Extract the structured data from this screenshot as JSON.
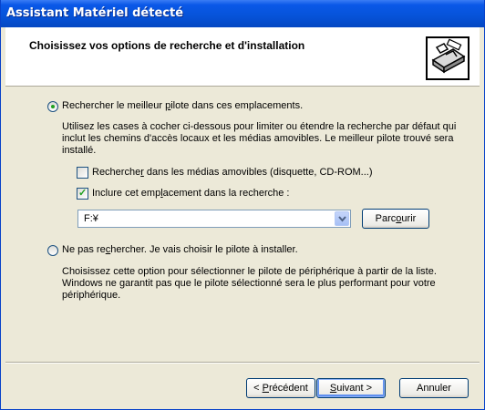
{
  "window": {
    "title": "Assistant Matériel détecté"
  },
  "header": {
    "heading": "Choisissez vos options de recherche et d'installation"
  },
  "options": {
    "search_best": {
      "label_pre": "Rechercher le meilleur ",
      "label_u": "p",
      "label_post": "ilote dans ces emplacements.",
      "description": "Utilisez les cases à cocher ci-dessous pour limiter ou étendre la recherche par défaut qui inclut les chemins d'accès locaux et les médias amovibles. Le meilleur pilote trouvé sera installé.",
      "checked": true
    },
    "removable_media": {
      "label_pre": "Recherche",
      "label_u": "r",
      "label_post": " dans les médias amovibles (disquette, CD-ROM...)",
      "checked": false
    },
    "include_location": {
      "label_pre": "Inclure cet emp",
      "label_u": "l",
      "label_post": "acement dans la recherche :",
      "checked": true
    },
    "location_value": "F:¥",
    "browse_button": {
      "pre": "Parc",
      "u": "o",
      "post": "urir"
    },
    "no_search": {
      "label_pre": "Ne pas re",
      "label_u": "c",
      "label_post": "hercher. Je vais choisir le pilote à installer.",
      "description": "Choisissez cette option pour sélectionner le pilote de périphérique à partir de la liste. Windows ne garantit pas que le pilote sélectionné sera le plus performant pour votre périphérique.",
      "checked": false
    }
  },
  "footer": {
    "back": {
      "pre": "< ",
      "u": "P",
      "post": "récédent"
    },
    "next": {
      "pre": "",
      "u": "S",
      "post": "uivant >"
    },
    "cancel": "Annuler"
  },
  "colors": {
    "titlebar": "#0653d8",
    "dialog": "#ece9d8",
    "radio_dot": "#21a121"
  },
  "icons": {
    "header": "hardware-wizard-icon",
    "dropdown": "chevron-down-icon"
  }
}
